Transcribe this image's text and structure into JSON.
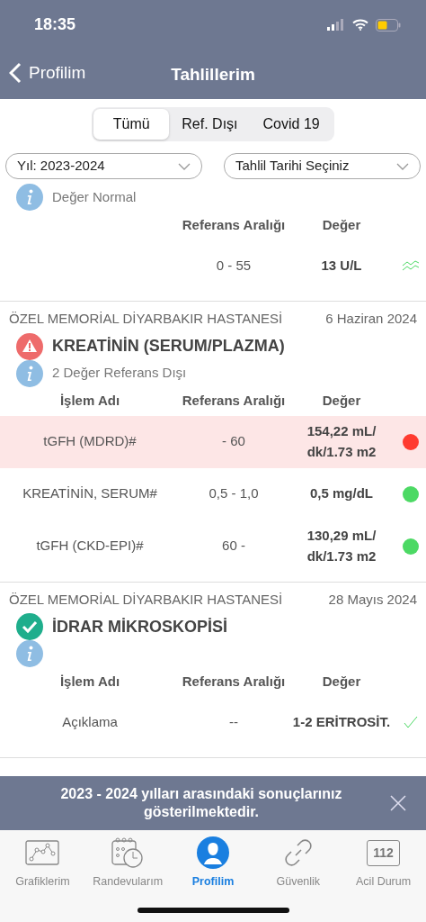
{
  "status_bar": {
    "time": "18:35"
  },
  "nav": {
    "back_label": "Profilim",
    "title": "Tahlillerim"
  },
  "segments": [
    {
      "label": "Tümü",
      "selected": true
    },
    {
      "label": "Ref. Dışı",
      "selected": false
    },
    {
      "label": "Covid 19",
      "selected": false
    }
  ],
  "filters": [
    {
      "value": "Yıl: 2023-2024"
    },
    {
      "value": "Tahlil Tarihi Seçiniz"
    }
  ],
  "groups": [
    {
      "info": "Değer Normal",
      "columns": {
        "range": "Referans Aralığı",
        "value": "Değer"
      },
      "rows": [
        {
          "range": "0 - 55",
          "value": "13 U/L",
          "flagged": false,
          "kind": "trend"
        }
      ]
    },
    {
      "hospital": "ÖZEL MEMORİAL DİYARBAKIR HASTANESİ",
      "date": "6 Haziran 2024",
      "kind": "alert",
      "title": "KREATİNİN (SERUM/PLAZMA)",
      "info": "2 Değer Referans Dışı",
      "columns": {
        "name": "İşlem Adı",
        "range": "Referans Aralığı",
        "value": "Değer"
      },
      "rows": [
        {
          "name": "tGFH (MDRD)#",
          "range": "- 60",
          "value": "154,22 mL/ dk/1.73 m2",
          "flagged": true,
          "kind": "dot",
          "color": "#ff3b30"
        },
        {
          "name": "KREATİNİN, SERUM#",
          "range": "0,5 - 1,0",
          "value": "0,5 mg/dL",
          "flagged": false,
          "kind": "dot",
          "color": "#4cd964"
        },
        {
          "name": "tGFH (CKD-EPI)#",
          "range": "60 -",
          "value": "130,29 mL/ dk/1.73 m2",
          "flagged": false,
          "kind": "dot",
          "color": "#4cd964"
        }
      ]
    },
    {
      "hospital": "ÖZEL MEMORİAL DİYARBAKIR HASTANESİ",
      "date": "28 Mayıs 2024",
      "kind": "ok",
      "title": "İDRAR MİKROSKOPİSİ",
      "columns": {
        "name": "İşlem Adı",
        "range": "Referans Aralığı",
        "value": "Değer"
      },
      "rows": [
        {
          "name": "Açıklama",
          "range": "--",
          "value": "1-2 ERİTROSİT.",
          "flagged": false,
          "kind": "check"
        }
      ]
    }
  ],
  "banner": {
    "text": "2023 - 2024 yılları arasındaki sonuçlarınız gösterilmektedir."
  },
  "tabbar": [
    {
      "label": "Grafiklerim",
      "selected": false
    },
    {
      "label": "Randevularım",
      "selected": false
    },
    {
      "label": "Profilim",
      "selected": true
    },
    {
      "label": "Güvenlik",
      "selected": false
    },
    {
      "label": "Acil Durum",
      "selected": false,
      "badge": "112"
    }
  ]
}
